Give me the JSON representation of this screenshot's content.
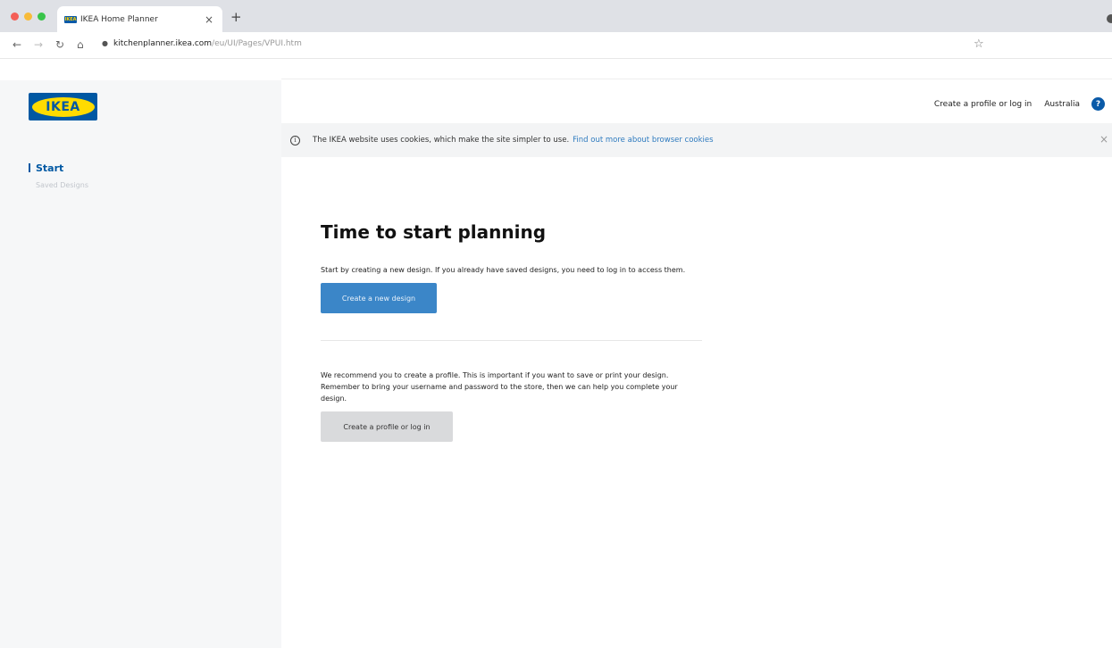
{
  "browser": {
    "tab_favicon": "IKEA",
    "tab_title": "IKEA Home Planner",
    "tab_close": "×",
    "new_tab": "+",
    "url_host": "kitchenplanner.ikea.com",
    "url_path": "/eu/UI/Pages/VPUI.htm",
    "icons": {
      "back": "back-arrow-icon",
      "forward": "forward-arrow-icon",
      "reload": "reload-icon",
      "home": "home-icon",
      "lock": "lock-icon",
      "bookmark": "star-icon"
    }
  },
  "header": {
    "logo_text": "IKEA",
    "profile_link": "Create a profile or log in",
    "country": "Australia",
    "help": "?"
  },
  "cookie_banner": {
    "info_glyph": "i",
    "text": "The IKEA website uses cookies, which make the site simpler to use.",
    "link": "Find out more about browser cookies",
    "close": "×"
  },
  "sidebar": {
    "items": [
      {
        "label": "Start"
      },
      {
        "label": "Saved Designs"
      }
    ]
  },
  "main": {
    "title": "Time to start planning",
    "intro": "Start by creating a new design. If you already have saved designs, you need to log in to access them.",
    "create_button": "Create a new design",
    "recommend": "We recommend you to create a profile. This is important if you want to save or print your design. Remember to bring your username and password to the store, then we can help you complete your design.",
    "profile_button": "Create a profile or log in"
  },
  "colors": {
    "ikea_blue": "#0058a3",
    "ikea_yellow": "#ffdb00",
    "primary_button": "#3b86c8",
    "secondary_button": "#d9dadc"
  }
}
